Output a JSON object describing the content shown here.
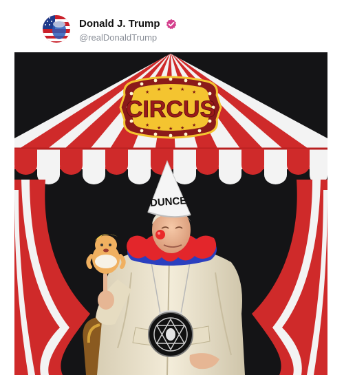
{
  "post": {
    "author": {
      "display_name": "Donald J. Trump",
      "handle": "@realDonaldTrump",
      "verified": true,
      "avatar_icon": "profile-avatar"
    },
    "image": {
      "sign_text": "CIRCUS",
      "hat_text": "DUNCE",
      "colors": {
        "tent_red": "#cf2a2a",
        "tent_white": "#f3f3f3",
        "background": "#141416",
        "sign_gold": "#f4c430",
        "sign_frame": "#8b1a1a",
        "robe": "#ece4cf",
        "collar_red": "#e3262b",
        "collar_blue": "#2b3fbf",
        "verified_badge": "#d43f8d"
      }
    }
  }
}
